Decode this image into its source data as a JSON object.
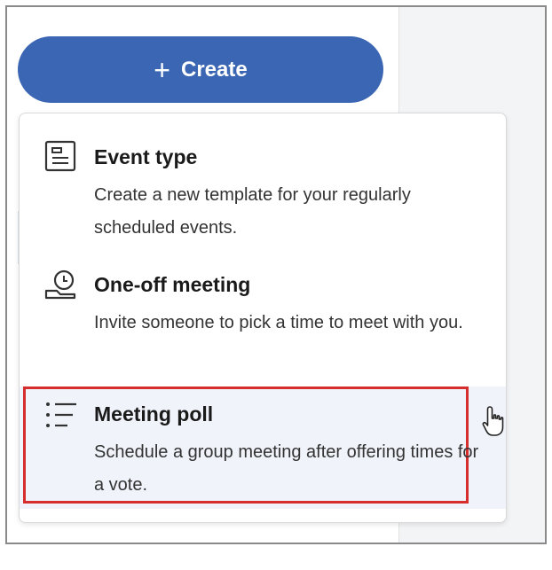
{
  "create_button": {
    "label": "Create",
    "icon": "plus-icon"
  },
  "menu": {
    "items": [
      {
        "title": "Event type",
        "description": "Create a new template for your regularly scheduled events.",
        "icon": "event-type-icon"
      },
      {
        "title": "One-off meeting",
        "description": "Invite someone to pick a time to meet with you.",
        "icon": "one-off-meeting-icon"
      },
      {
        "title": "Meeting poll",
        "description": "Schedule a group meeting after offering times for a vote.",
        "icon": "meeting-poll-icon",
        "highlighted": true
      }
    ]
  },
  "colors": {
    "primary": "#3b66b3",
    "highlight": "#d62d2d",
    "hover_background": "#f0f4fa"
  }
}
